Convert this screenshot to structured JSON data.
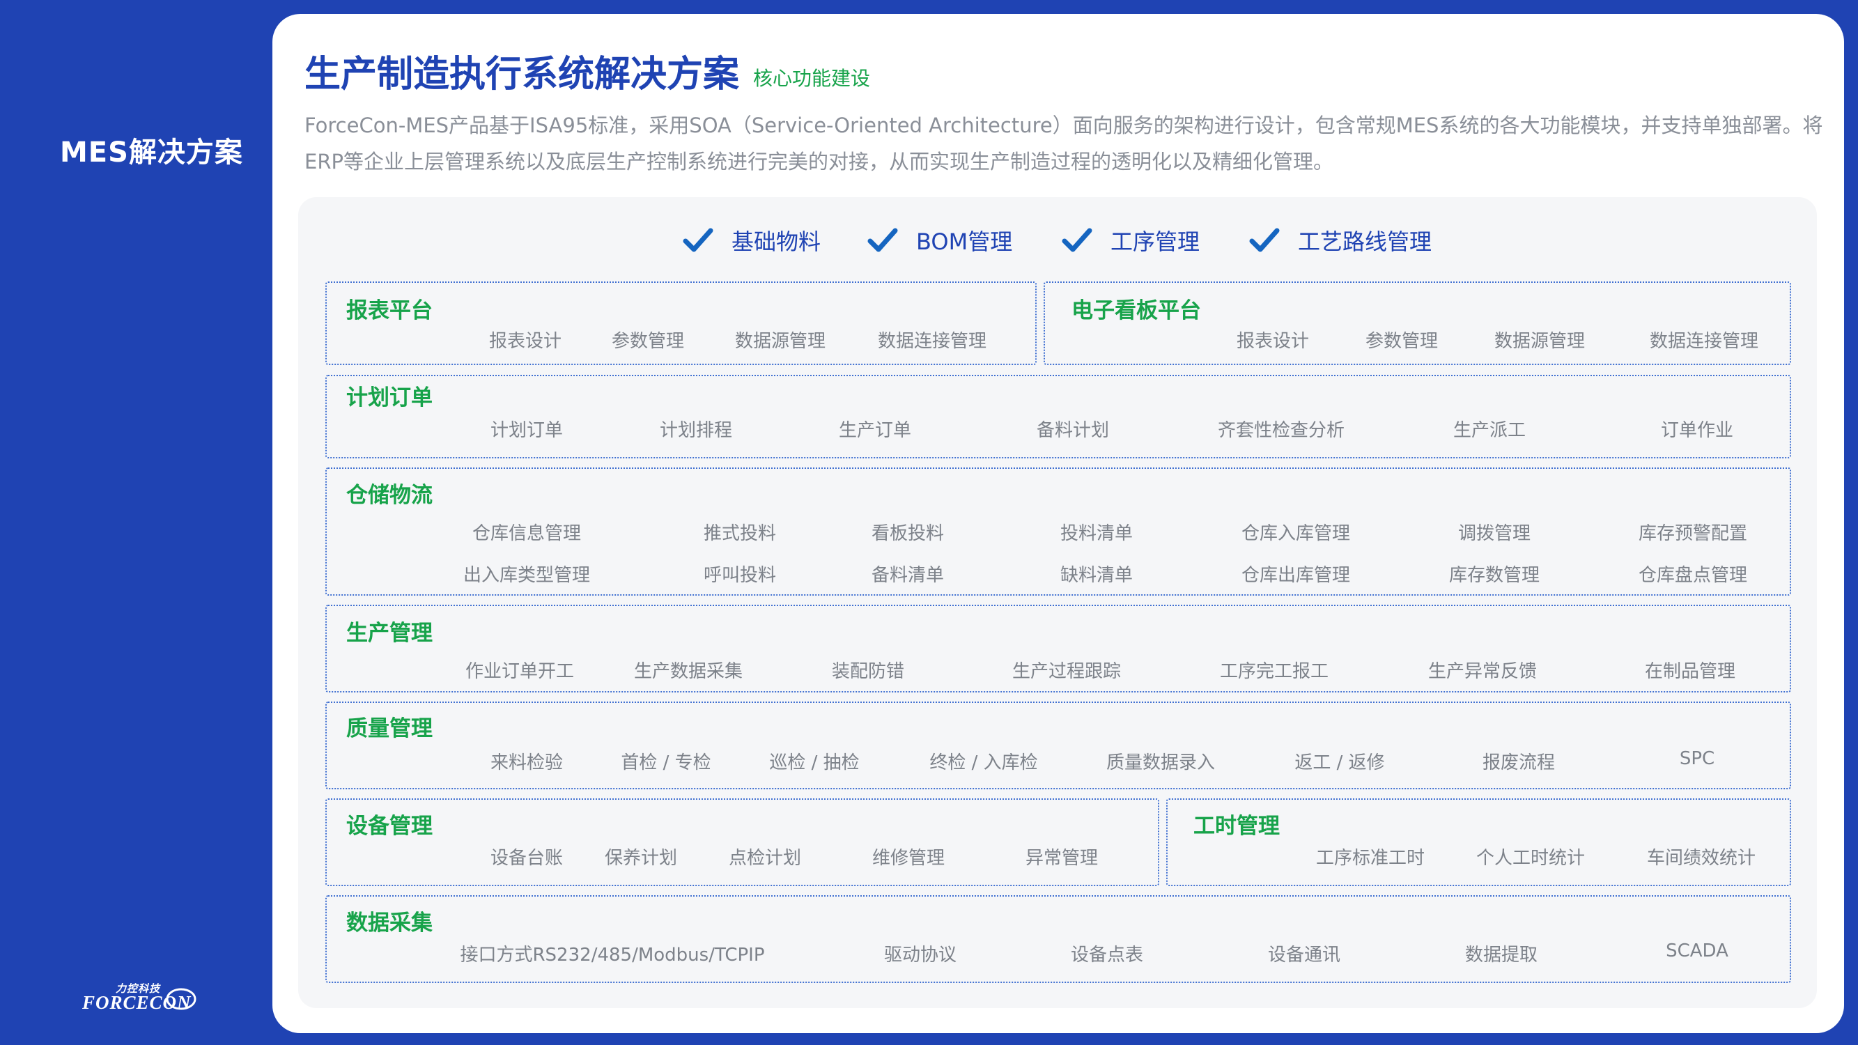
{
  "sidebar": {
    "title": "MES解决方案"
  },
  "logo": {
    "cn": "力控科技",
    "en": "FORCECON"
  },
  "header": {
    "title": "生产制造执行系统解决方案",
    "subtitle": "核心功能建设",
    "desc_line1": "ForceCon-MES产品基于ISA95标准，采用SOA（Service-Oriented  Architecture）面向服务的架构进行设计，包含常规MES系统的各大功能模块，并支持单独部署。将",
    "desc_line2": "ERP等企业上层管理系统以及底层生产控制系统进行完美的对接，从而实现生产制造过程的透明化以及精细化管理。"
  },
  "core_features": [
    "基础物料",
    "BOM管理",
    "工序管理",
    "工艺路线管理"
  ],
  "modules": {
    "report": {
      "title": "报表平台",
      "items": [
        "报表设计",
        "参数管理",
        "数据源管理",
        "数据连接管理"
      ]
    },
    "kanban": {
      "title": "电子看板平台",
      "items": [
        "报表设计",
        "参数管理",
        "数据源管理",
        "数据连接管理"
      ]
    },
    "plan": {
      "title": "计划订单",
      "items": [
        "计划订单",
        "计划排程",
        "生产订单",
        "备料计划",
        "齐套性检查分析",
        "生产派工",
        "订单作业"
      ]
    },
    "warehouse": {
      "title": "仓储物流",
      "row1": [
        "仓库信息管理",
        "推式投料",
        "看板投料",
        "投料清单",
        "仓库入库管理",
        "调拨管理",
        "库存预警配置"
      ],
      "row2": [
        "出入库类型管理",
        "呼叫投料",
        "备料清单",
        "缺料清单",
        "仓库出库管理",
        "库存数管理",
        "仓库盘点管理"
      ]
    },
    "production": {
      "title": "生产管理",
      "items": [
        "作业订单开工",
        "生产数据采集",
        "装配防错",
        "生产过程跟踪",
        "工序完工报工",
        "生产异常反馈",
        "在制品管理"
      ]
    },
    "quality": {
      "title": "质量管理",
      "items": [
        "来料检验",
        "首检 / 专检",
        "巡检 / 抽检",
        "终检 / 入库检",
        "质量数据录入",
        "返工 / 返修",
        "报废流程",
        "SPC"
      ]
    },
    "equipment": {
      "title": "设备管理",
      "items": [
        "设备台账",
        "保养计划",
        "点检计划",
        "维修管理",
        "异常管理"
      ]
    },
    "worktime": {
      "title": "工时管理",
      "items": [
        "工序标准工时",
        "个人工时统计",
        "车间绩效统计"
      ]
    },
    "datacollect": {
      "title": "数据采集",
      "items": [
        "接口方式RS232/485/Modbus/TCPIP",
        "驱动协议",
        "设备点表",
        "设备通讯",
        "数据提取",
        "SCADA"
      ]
    }
  },
  "colors": {
    "brand_blue": "#1f43b3",
    "green": "#17a34a",
    "gray_text": "#7d828a",
    "panel_bg": "#f5f6f8"
  }
}
